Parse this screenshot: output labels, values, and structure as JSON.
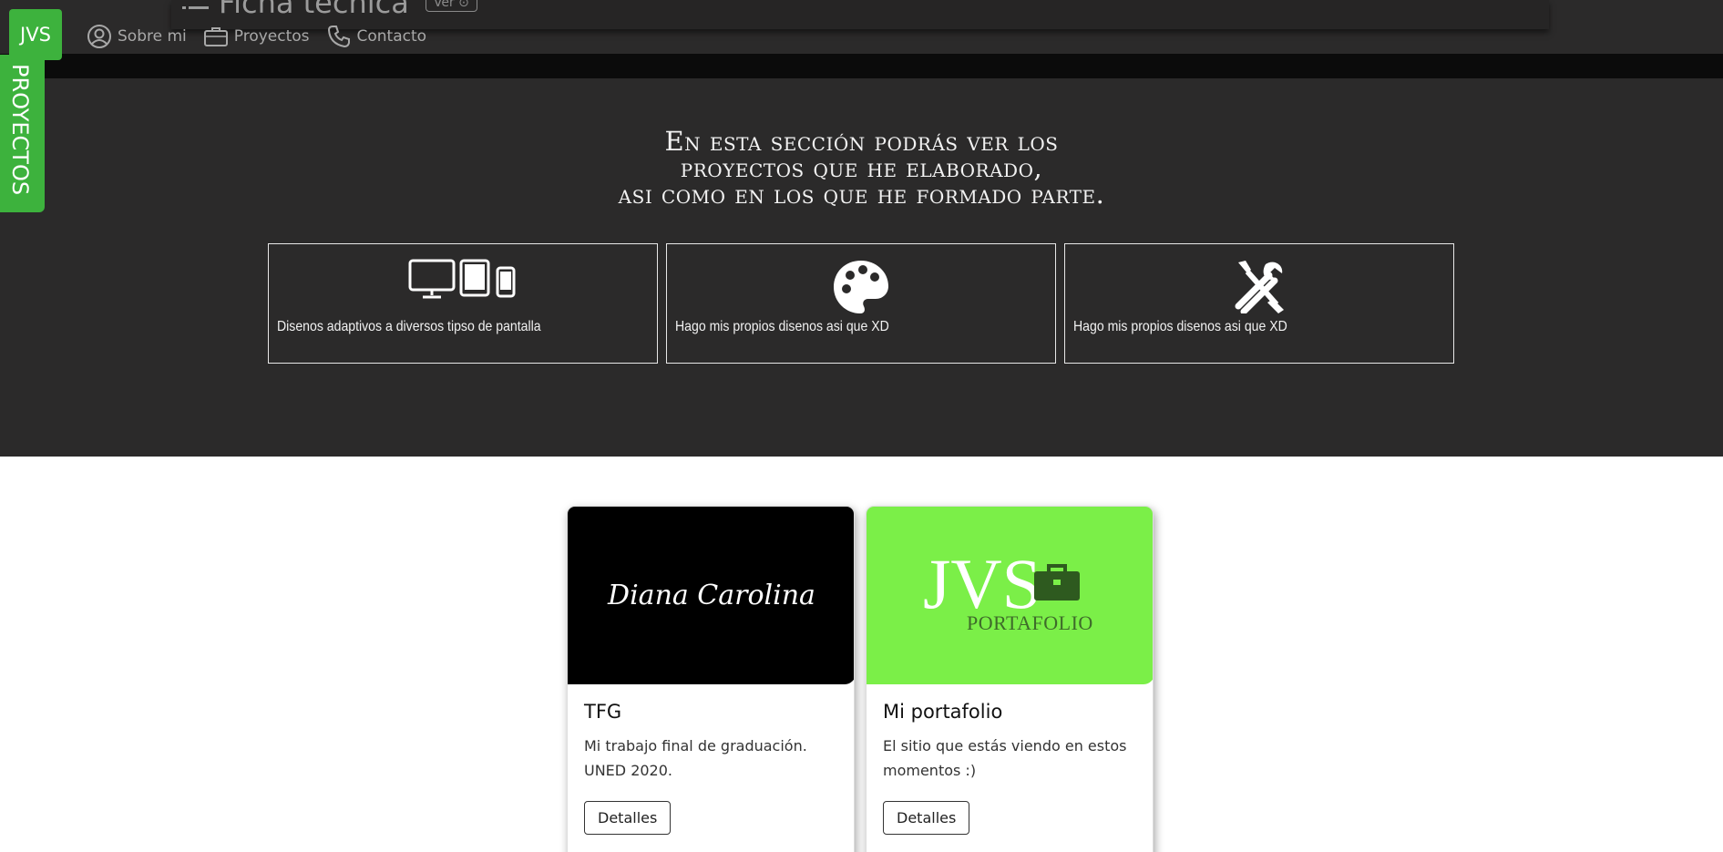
{
  "header": {
    "logo_text": "JVS",
    "ficha_title": "Ficha técnica",
    "ficha_button": "Ver ⊙",
    "nav": [
      {
        "label": "Sobre mi",
        "icon": "user-circle-icon"
      },
      {
        "label": "Proyectos",
        "icon": "briefcase-icon"
      },
      {
        "label": "Contacto",
        "icon": "phone-icon"
      }
    ]
  },
  "side_tab": {
    "label": "PROYECTOS"
  },
  "hero": {
    "title_lines": [
      "En esta sección podrás ver los",
      "proyectos que he elaborado,",
      "asi como en los que he formado parte."
    ],
    "features": [
      {
        "icon": "devices-icon",
        "text": "Disenos adaptivos a diversos tipso de pantalla"
      },
      {
        "icon": "palette-icon",
        "text": "Hago mis propios disenos asi que XD"
      },
      {
        "icon": "tools-icon",
        "text": "Hago mis propios disenos asi que XD"
      }
    ]
  },
  "projects": [
    {
      "image_text": "Diana Carolina",
      "title": "TFG",
      "text": "Mi trabajo final de graduación. UNED 2020.",
      "button": "Detalles"
    },
    {
      "image_logo": "JVS",
      "image_sub": "PORTAFOLIO",
      "title": "Mi portafolio",
      "text": "El sitio que estás viendo en estos momentos :)",
      "button": "Detalles"
    }
  ],
  "colors": {
    "accent_green": "#3db23d",
    "hero_bg": "#2b2a2a",
    "portfolio_green": "#7bef48"
  }
}
